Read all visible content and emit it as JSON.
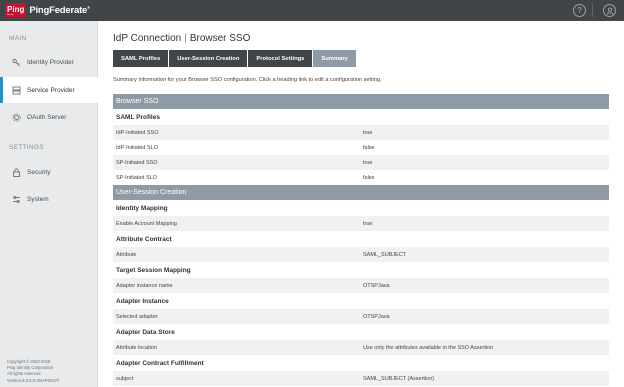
{
  "brand": {
    "badge_top": "Ping",
    "badge_bottom": "Identity",
    "name": "PingFederate",
    "mark": "®"
  },
  "header_icons": [
    "help-icon",
    "user-icon"
  ],
  "sidebar": {
    "main_label": "MAIN",
    "main_items": [
      {
        "label": "Identity Provider",
        "icon": "key-icon"
      },
      {
        "label": "Service Provider",
        "icon": "server-icon"
      },
      {
        "label": "OAuth Server",
        "icon": "gear-cog-icon"
      }
    ],
    "settings_label": "SETTINGS",
    "settings_items": [
      {
        "label": "Security",
        "icon": "lock-icon"
      },
      {
        "label": "System",
        "icon": "sliders-icon"
      }
    ],
    "footer": [
      "Copyright © 2003-2019",
      "Ping Identity Corporation",
      "All rights reserved",
      "Version 9.3.0.5-SNAPSHOT"
    ]
  },
  "page": {
    "title_left": "IdP Connection",
    "title_sep": "|",
    "title_right": "Browser SSO",
    "tabs": [
      "SAML Profiles",
      "User-Session Creation",
      "Protocol Settings",
      "Summary"
    ],
    "active_tab": "Summary",
    "description": "Summary information for your Browser SSO configuration. Click a heading link to edit a configuration setting."
  },
  "summary": {
    "sections": [
      {
        "header": "Browser SSO",
        "groups": [
          {
            "title": "SAML Profiles",
            "rows": [
              {
                "k": "IdP-Initiated SSO",
                "v": "true"
              },
              {
                "k": "IdP-Initiated SLO",
                "v": "false"
              },
              {
                "k": "SP-Initiated SSO",
                "v": "true"
              },
              {
                "k": "SP-Initiated SLO",
                "v": "false"
              }
            ]
          }
        ]
      },
      {
        "header": "User-Session Creation",
        "groups": [
          {
            "title": "Identity Mapping",
            "rows": [
              {
                "k": "Enable Account Mapping",
                "v": "true"
              }
            ]
          },
          {
            "title": "Attribute Contract",
            "rows": [
              {
                "k": "Attribute",
                "v": "SAML_SUBJECT"
              }
            ]
          },
          {
            "title": "Target Session Mapping",
            "rows": [
              {
                "k": "Adapter instance name",
                "v": "OTSPJava"
              }
            ]
          },
          {
            "title": "Adapter Instance",
            "rows": [
              {
                "k": "Selected adapter",
                "v": "OTSPJava"
              }
            ]
          },
          {
            "title": "Adapter Data Store",
            "rows": [
              {
                "k": "Attribute location",
                "v": "Use only the attributes available in the SSO Assertion"
              }
            ]
          },
          {
            "title": "Adapter Contract Fulfillment",
            "rows": [
              {
                "k": "subject",
                "v": "SAML_SUBJECT (Assertion)"
              }
            ]
          }
        ]
      }
    ]
  },
  "colors": {
    "topbar": "#3f4548",
    "accent": "#2a8fc9",
    "section_header": "#8e9aa6",
    "brand_red": "#c8102e"
  }
}
